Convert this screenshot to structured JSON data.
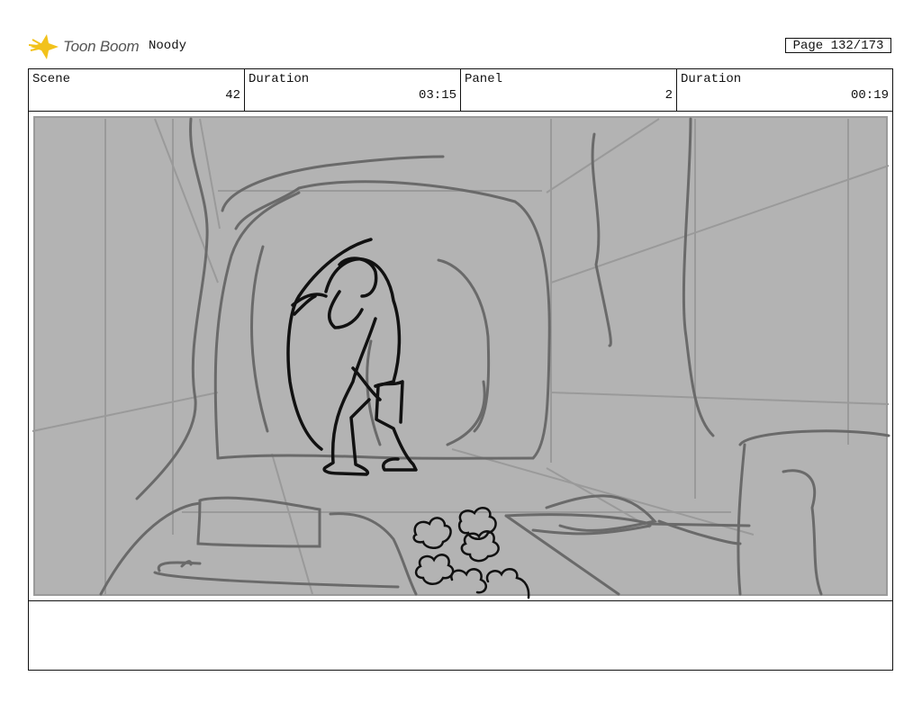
{
  "header": {
    "logo_text": "Toon Boom",
    "project_name": "Noody",
    "page_label": "Page 132/173"
  },
  "info": {
    "scene_label": "Scene",
    "scene_value": "42",
    "scene_duration_label": "Duration",
    "scene_duration_value": "03:15",
    "panel_label": "Panel",
    "panel_value": "2",
    "panel_duration_label": "Duration",
    "panel_duration_value": "00:19"
  },
  "panel": {
    "background_color": "#b3b3b3",
    "line_color": "#6a6a6a",
    "figure_color": "#111111"
  },
  "notes": {
    "text": ""
  }
}
